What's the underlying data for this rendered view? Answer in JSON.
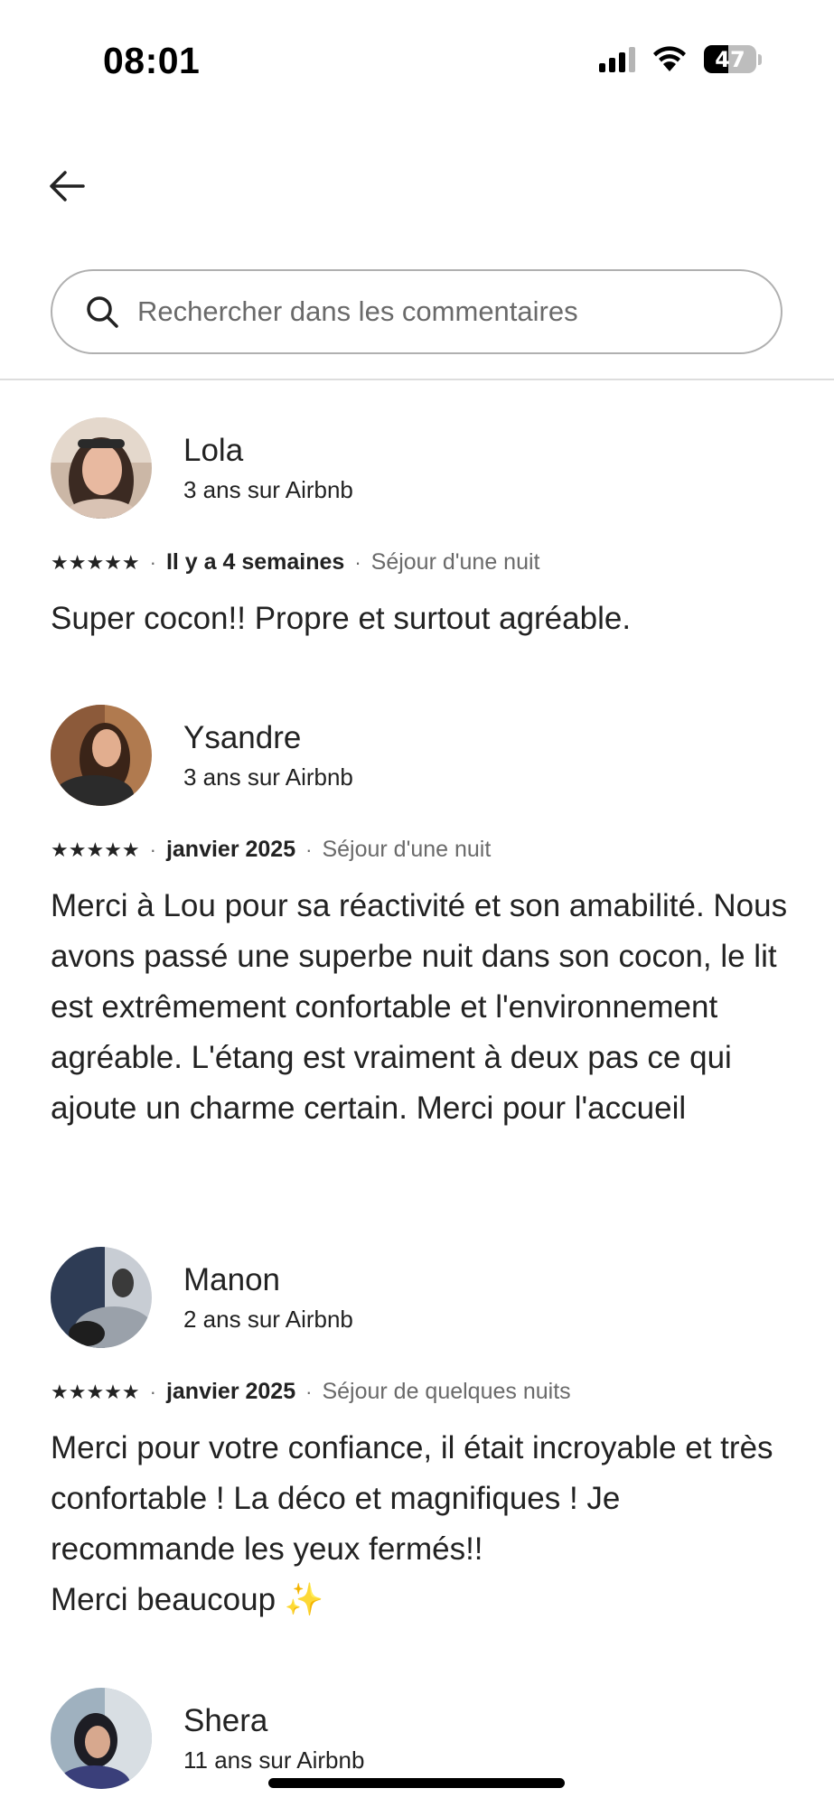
{
  "status_bar": {
    "time": "08:01",
    "battery": "47"
  },
  "header": {
    "back_icon": "arrow-left-icon",
    "search_placeholder": "Rechercher dans les commentaires"
  },
  "reviews": [
    {
      "name": "Lola",
      "tenure": "3 ans sur Airbnb",
      "rating": 5,
      "stars": "★★★★★",
      "date": "Il y a 4 semaines",
      "stay": "Séjour d'une nuit",
      "text": "Super cocon!! Propre et surtout agréable."
    },
    {
      "name": "Ysandre",
      "tenure": "3 ans sur Airbnb",
      "rating": 5,
      "stars": "★★★★★",
      "date": "janvier 2025",
      "stay": "Séjour d'une nuit",
      "text": "Merci à Lou pour sa réactivité et son amabilité. Nous avons passé une superbe nuit dans son cocon, le lit est extrêmement confortable et l'environnement agréable. L'étang est vraiment à deux pas ce qui ajoute un charme certain. Merci pour l'accueil"
    },
    {
      "name": "Manon",
      "tenure": "2 ans sur Airbnb",
      "rating": 5,
      "stars": "★★★★★",
      "date": "janvier 2025",
      "stay": "Séjour de quelques nuits",
      "text": "Merci pour votre confiance, il était incroyable et très confortable ! La déco et magnifiques ! Je recommande les yeux fermés!!\nMerci beaucoup",
      "emoji": "✨"
    },
    {
      "name": "Shera",
      "tenure": "11 ans sur Airbnb"
    }
  ]
}
